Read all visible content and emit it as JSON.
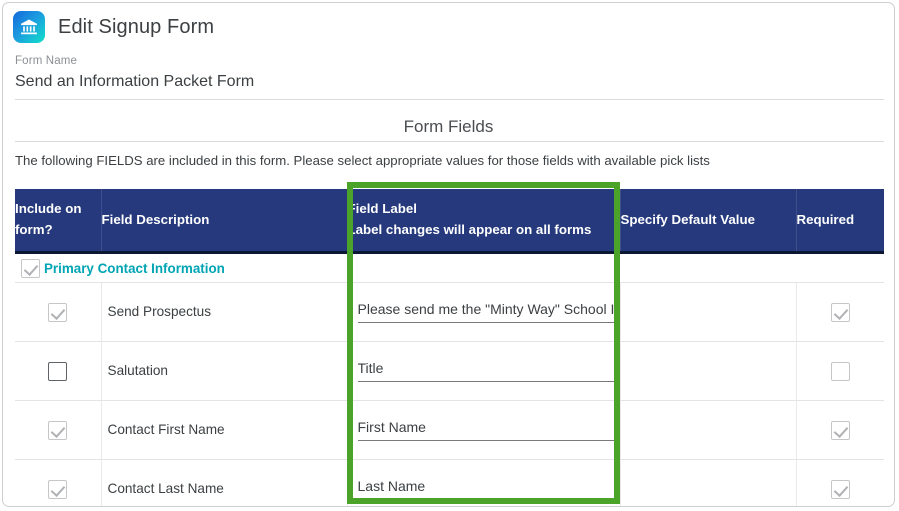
{
  "header": {
    "title": "Edit Signup Form",
    "icon": "bank-icon"
  },
  "form_name": {
    "label": "Form Name",
    "value": "Send an Information Packet Form"
  },
  "section": {
    "title": "Form Fields",
    "instructions": "The following FIELDS are included in this form. Please select appropriate values for those fields with available pick lists"
  },
  "table": {
    "columns": [
      {
        "label": "Include on form?"
      },
      {
        "label": "Field Description"
      },
      {
        "label": "Field Label",
        "sublabel": "Label changes will appear on all forms"
      },
      {
        "label": "Specify Default Value"
      },
      {
        "label": "Required"
      }
    ],
    "section_row": {
      "name": "Primary Contact Information",
      "include_checked": true
    },
    "rows": [
      {
        "include_checked": true,
        "description": "Send Prospectus",
        "field_label": "Please send me the \"Minty Way\" School Information Packet",
        "default_value": "",
        "required_checked": true
      },
      {
        "include_checked": false,
        "description": "Salutation",
        "field_label": "Title",
        "default_value": "",
        "required_checked": false
      },
      {
        "include_checked": true,
        "description": "Contact First Name",
        "field_label": "First Name",
        "default_value": "",
        "required_checked": true
      },
      {
        "include_checked": true,
        "description": "Contact Last Name",
        "field_label": "Last Name",
        "default_value": "",
        "required_checked": true
      }
    ]
  },
  "colors": {
    "header_navy": "#25397c",
    "highlight_green": "#4ca32a",
    "section_teal": "#00a5b5",
    "icon_gradient_start": "#1468d8",
    "icon_gradient_end": "#12e1c8"
  }
}
